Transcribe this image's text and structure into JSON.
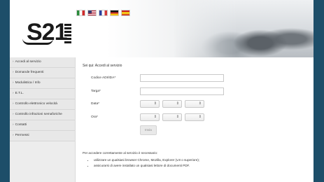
{
  "header": {
    "logo_text": "S21",
    "flags": [
      "it",
      "en",
      "fr",
      "de",
      "es"
    ]
  },
  "sidebar": {
    "items": [
      {
        "label": "Accedi al servizio"
      },
      {
        "label": "Domande frequenti"
      },
      {
        "label": "Modulistica / Info"
      },
      {
        "label": "E.T.L."
      },
      {
        "label": "Controllo elettronico velocità"
      },
      {
        "label": "Controllo infrazioni semaforiche"
      },
      {
        "label": "Contatti"
      },
      {
        "label": "Permessi"
      }
    ]
  },
  "main": {
    "breadcrumb": "Sei qui: Accedi al servizio",
    "form": {
      "codice_label": "Codice ADI/IDA*",
      "codice_value": "",
      "targa_label": "Targa*",
      "targa_value": "",
      "data_label": "Data*",
      "ora_label": "Ora*",
      "submit_label": "Invia"
    },
    "info": {
      "title": "Per accedere correttamente al servizio è necessario:",
      "items": [
        "utilizzare un qualsiasi browser Chrome, Mozilla, Explorer (v.8 o superiore);",
        "assicurarsi di avere installato un qualsiasi lettore di documenti PDF."
      ]
    }
  },
  "colors": {
    "background": "#1d4e69",
    "sidebar": "#ededed",
    "text": "#333333"
  }
}
